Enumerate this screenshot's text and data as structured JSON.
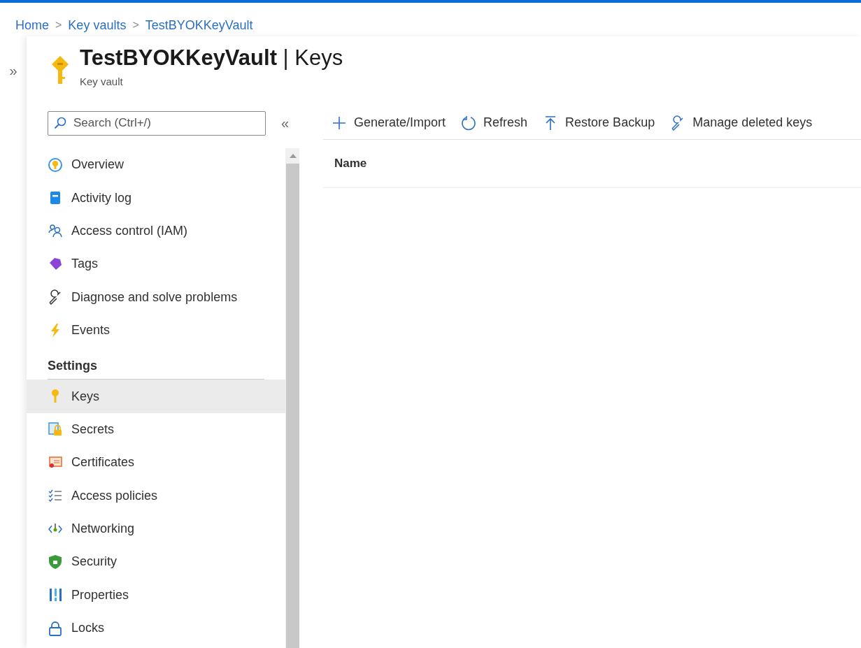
{
  "breadcrumb": [
    {
      "label": "Home"
    },
    {
      "label": "Key vaults"
    },
    {
      "label": "TestBYOKKeyVault"
    }
  ],
  "breadcrumb_separator": ">",
  "expand_glyph": "»",
  "header": {
    "title": "**TestBYOKKeyVault** | Keys",
    "subtitle": "Key vault"
  },
  "search": {
    "placeholder": "Search (Ctrl+/)"
  },
  "collapse_glyph": "«",
  "menu": [
    {
      "label": "Overview",
      "selected": false
    },
    {
      "label": "Activity log",
      "selected": false
    },
    {
      "label": "Access control (IAM)",
      "selected": false
    },
    {
      "label": "Tags",
      "selected": false
    },
    {
      "label": "Diagnose and solve problems",
      "selected": false
    },
    {
      "label": "Events",
      "selected": false
    }
  ],
  "sections": [
    {
      "title": "Settings",
      "items": [
        {
          "label": "Keys",
          "selected": true
        },
        {
          "label": "Secrets",
          "selected": false
        },
        {
          "label": "Certificates",
          "selected": false
        },
        {
          "label": "Access policies",
          "selected": false
        },
        {
          "label": "Networking",
          "selected": false
        },
        {
          "label": "Security",
          "selected": false
        },
        {
          "label": "Properties",
          "selected": false
        },
        {
          "label": "Locks",
          "selected": false
        }
      ]
    }
  ],
  "toolbar": [
    {
      "label": "Generate/Import"
    },
    {
      "label": "Refresh"
    },
    {
      "label": "Restore Backup"
    },
    {
      "label": "Manage deleted keys"
    }
  ],
  "table": {
    "columns": [
      "Name"
    ]
  }
}
